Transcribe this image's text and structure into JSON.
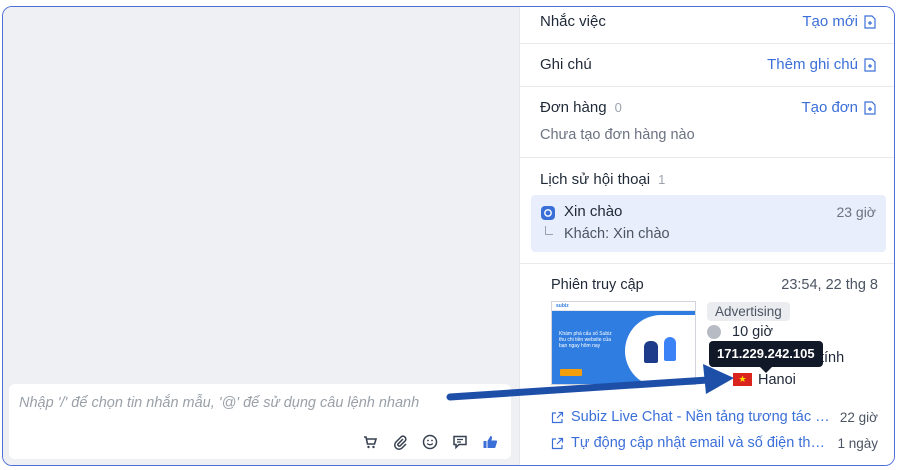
{
  "composer": {
    "placeholder": "Nhập '/' để chọn tin nhắn mẫu, '@' để sử dụng câu lệnh nhanh",
    "tools": [
      "cart-icon",
      "paperclip-icon",
      "emoji-icon",
      "message-plus-icon",
      "thumbs-up-icon"
    ]
  },
  "info": {
    "reminder": {
      "title": "Nhắc việc",
      "action": "Tạo mới"
    },
    "notes": {
      "title": "Ghi chú",
      "action": "Thêm ghi chú"
    },
    "orders": {
      "title": "Đơn hàng",
      "count": "0",
      "action": "Tạo đơn",
      "empty": "Chưa tạo đơn hàng nào"
    },
    "history": {
      "title": "Lịch sử hội thoại",
      "count": "1",
      "conversation": {
        "title": "Xin chào",
        "time": "23 giờ",
        "preview": "Khách: Xin chào"
      }
    },
    "visit": {
      "title": "Phiên truy cập",
      "time": "23:54, 22 thg 8",
      "tag": "Advertising",
      "duration": "10 giờ",
      "device_partial": "tính",
      "city": "Hanoi",
      "ip_tooltip": "171.229.242.105",
      "thumbnail_logo": "subiz",
      "thumbnail_text": "Khám phá cấu số Subiz thu chi tiền website của bạn ngay hôm nay",
      "links": [
        {
          "text": "Subiz Live Chat - Nền tảng tương tác và chăm sóc khách hàng",
          "age": "22 giờ"
        },
        {
          "text": "Tự động cập nhật email và số điện thoại của khách hàng",
          "age": "1 ngày"
        }
      ]
    }
  },
  "colors": {
    "accent": "#3b6fd8",
    "frame": "#4f6fd8",
    "arrow": "#1e4fa8",
    "tooltip": "#111827"
  }
}
